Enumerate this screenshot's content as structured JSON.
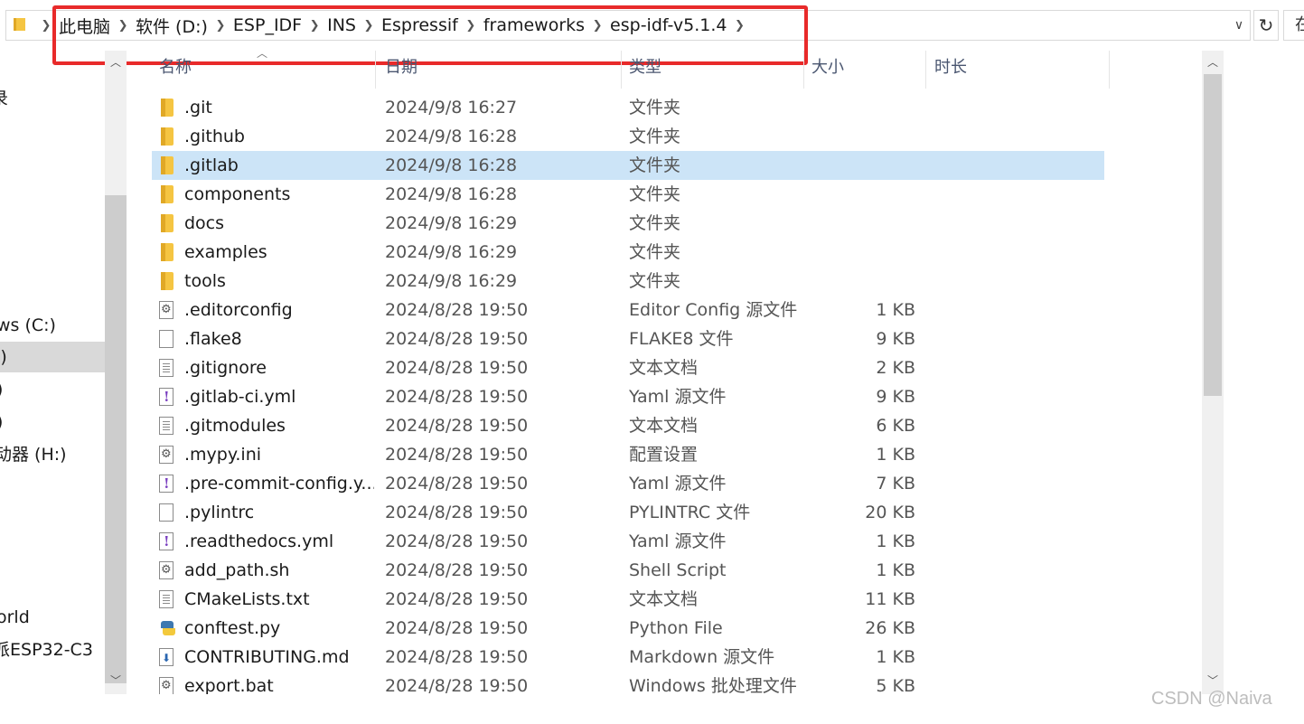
{
  "address_bar": {
    "crumbs": [
      "此电脑",
      "软件 (D:)",
      "ESP_IDF",
      "INS",
      "Espressif",
      "frameworks",
      "esp-idf-v5.1.4"
    ],
    "search_placeholder": "在"
  },
  "nav": {
    "items": [
      {
        "label": "录",
        "selected": false
      },
      {
        "label": "ws (C:)",
        "selected": false
      },
      {
        "label": ":)",
        "selected": true
      },
      {
        "label": ")",
        "selected": false
      },
      {
        "label": ")",
        "selected": false
      },
      {
        "label": "动器 (H:)",
        "selected": false
      },
      {
        "label": "orld",
        "selected": false
      },
      {
        "label": "派ESP32-C3",
        "selected": false
      }
    ]
  },
  "columns": {
    "name": "名称",
    "date": "日期",
    "type": "类型",
    "size": "大小",
    "duration": "时长"
  },
  "files": [
    {
      "name": ".git",
      "date": "2024/9/8 16:27",
      "type": "文件夹",
      "size": "",
      "icon": "folder-icon"
    },
    {
      "name": ".github",
      "date": "2024/9/8 16:28",
      "type": "文件夹",
      "size": "",
      "icon": "folder-icon"
    },
    {
      "name": ".gitlab",
      "date": "2024/9/8 16:28",
      "type": "文件夹",
      "size": "",
      "icon": "folder-icon",
      "selected": true
    },
    {
      "name": "components",
      "date": "2024/9/8 16:28",
      "type": "文件夹",
      "size": "",
      "icon": "folder-icon"
    },
    {
      "name": "docs",
      "date": "2024/9/8 16:29",
      "type": "文件夹",
      "size": "",
      "icon": "folder-icon"
    },
    {
      "name": "examples",
      "date": "2024/9/8 16:29",
      "type": "文件夹",
      "size": "",
      "icon": "folder-icon"
    },
    {
      "name": "tools",
      "date": "2024/9/8 16:29",
      "type": "文件夹",
      "size": "",
      "icon": "folder-icon"
    },
    {
      "name": ".editorconfig",
      "date": "2024/8/28 19:50",
      "type": "Editor Config 源文件",
      "size": "1 KB",
      "icon": "config-file-icon"
    },
    {
      "name": ".flake8",
      "date": "2024/8/28 19:50",
      "type": "FLAKE8 文件",
      "size": "9 KB",
      "icon": "blank-file-icon"
    },
    {
      "name": ".gitignore",
      "date": "2024/8/28 19:50",
      "type": "文本文档",
      "size": "2 KB",
      "icon": "text-file-icon"
    },
    {
      "name": ".gitlab-ci.yml",
      "date": "2024/8/28 19:50",
      "type": "Yaml 源文件",
      "size": "9 KB",
      "icon": "yaml-file-icon"
    },
    {
      "name": ".gitmodules",
      "date": "2024/8/28 19:50",
      "type": "文本文档",
      "size": "6 KB",
      "icon": "text-file-icon"
    },
    {
      "name": ".mypy.ini",
      "date": "2024/8/28 19:50",
      "type": "配置设置",
      "size": "1 KB",
      "icon": "settings-file-icon"
    },
    {
      "name": ".pre-commit-config.y...",
      "date": "2024/8/28 19:50",
      "type": "Yaml 源文件",
      "size": "7 KB",
      "icon": "yaml-file-icon"
    },
    {
      "name": ".pylintrc",
      "date": "2024/8/28 19:50",
      "type": "PYLINTRC 文件",
      "size": "20 KB",
      "icon": "blank-file-icon"
    },
    {
      "name": ".readthedocs.yml",
      "date": "2024/8/28 19:50",
      "type": "Yaml 源文件",
      "size": "1 KB",
      "icon": "yaml-file-icon"
    },
    {
      "name": "add_path.sh",
      "date": "2024/8/28 19:50",
      "type": "Shell Script",
      "size": "1 KB",
      "icon": "script-file-icon"
    },
    {
      "name": "CMakeLists.txt",
      "date": "2024/8/28 19:50",
      "type": "文本文档",
      "size": "11 KB",
      "icon": "text-file-icon"
    },
    {
      "name": "conftest.py",
      "date": "2024/8/28 19:50",
      "type": "Python File",
      "size": "26 KB",
      "icon": "python-file-icon"
    },
    {
      "name": "CONTRIBUTING.md",
      "date": "2024/8/28 19:50",
      "type": "Markdown 源文件",
      "size": "1 KB",
      "icon": "markdown-file-icon"
    },
    {
      "name": "export.bat",
      "date": "2024/8/28 19:50",
      "type": "Windows 批处理文件",
      "size": "5 KB",
      "icon": "script-file-icon"
    }
  ],
  "watermark": "CSDN @Naiva"
}
